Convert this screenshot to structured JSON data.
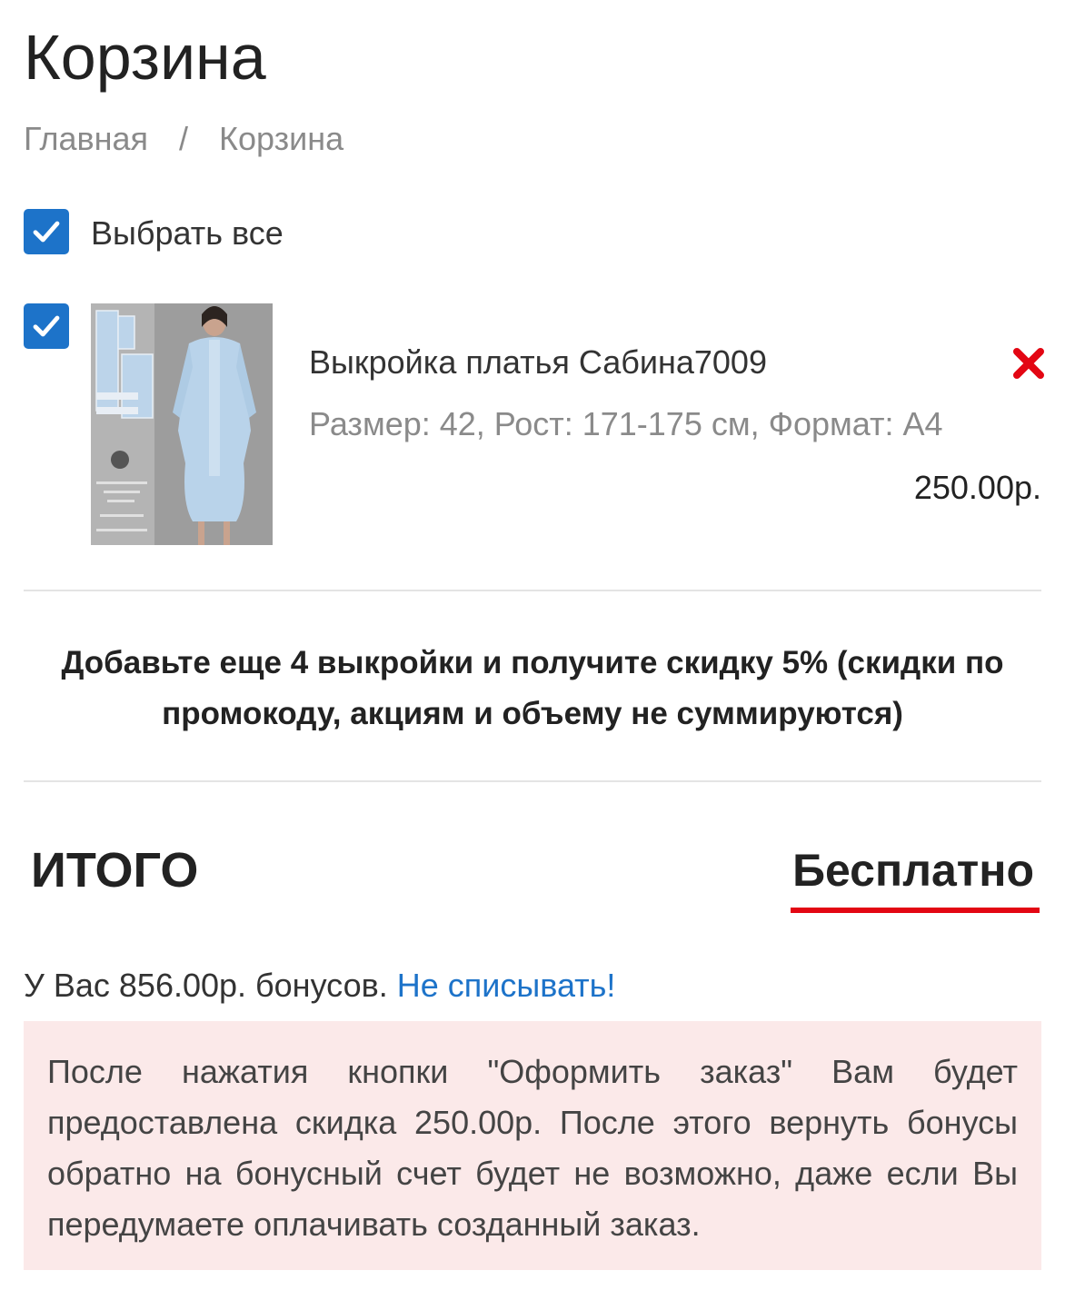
{
  "page": {
    "title": "Корзина"
  },
  "breadcrumb": {
    "home": "Главная",
    "separator": "/",
    "current": "Корзина"
  },
  "select_all": {
    "label": "Выбрать все",
    "checked": true
  },
  "cart_items": [
    {
      "name": "Выкройка платья Сабина7009",
      "meta": "Размер: 42, Рост: 171-175 см, Формат: А4",
      "price": "250.00р.",
      "checked": true,
      "remove_icon": "close-x-icon"
    }
  ],
  "promo": {
    "text": "Добавьте еще 4 выкройки и получите скидку 5% (скидки по промокоду, акциям и объему не суммируются)"
  },
  "total": {
    "label": "ИТОГО",
    "value": "Бесплатно",
    "underline_color": "#e30613"
  },
  "bonus": {
    "text": "У Вас 856.00р. бонусов.",
    "link": "Не списывать!"
  },
  "notice": {
    "text": "После нажатия кнопки \"Оформить заказ\" Вам будет предоставлена скидка 250.00р. После этого вернуть бонусы обратно на бонусный счет будет не возможно, даже если Вы передумаете оплачивать созданный заказ."
  },
  "colors": {
    "accent": "#1d73c9",
    "remove": "#e30613",
    "notice_bg": "#fbe9e9"
  }
}
